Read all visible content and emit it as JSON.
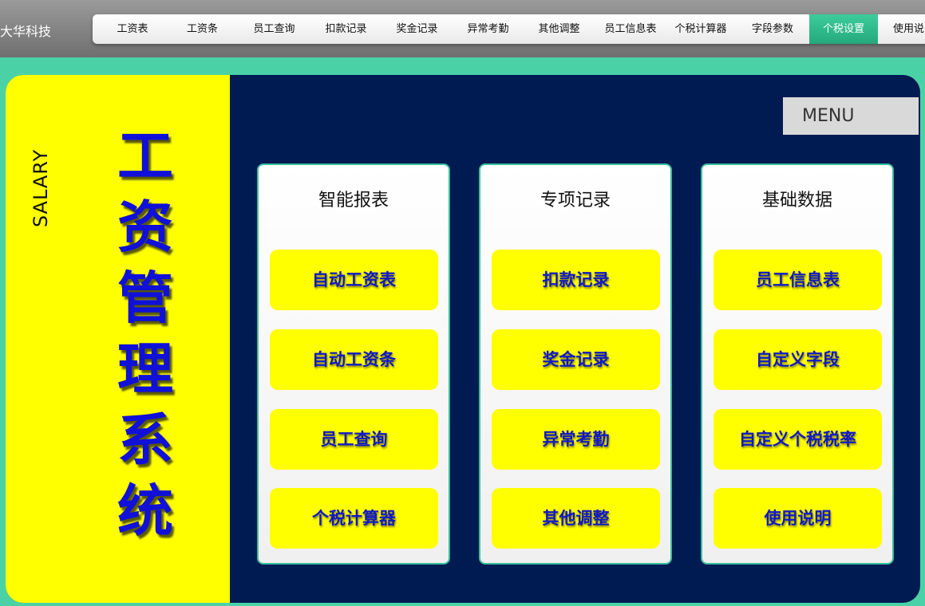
{
  "company": "大华科技",
  "nav": {
    "items": [
      "工资表",
      "工资条",
      "员工查询",
      "扣款记录",
      "奖金记录",
      "异常考勤",
      "其他调整",
      "员工信息表",
      "个税计算器",
      "字段参数",
      "个税设置",
      "使用说明"
    ],
    "active": "个税设置"
  },
  "side": {
    "subtitle": "SALARY",
    "title": "工资管理系统"
  },
  "menu_label": "MENU",
  "cards": [
    {
      "title": "智能报表",
      "buttons": [
        "自动工资表",
        "自动工资条",
        "员工查询",
        "个税计算器"
      ]
    },
    {
      "title": "专项记录",
      "buttons": [
        "扣款记录",
        "奖金记录",
        "异常考勤",
        "其他调整"
      ]
    },
    {
      "title": "基础数据",
      "buttons": [
        "员工信息表",
        "自定义字段",
        "自定义个税税率",
        "使用说明"
      ]
    }
  ],
  "colors": {
    "background": "#4ad2a6",
    "panel": "#001a52",
    "sidebar": "#ffff00",
    "button": "#ffff00",
    "button_text": "#1018c8",
    "title_text": "#1010d8",
    "active_nav": "#2bb585"
  }
}
